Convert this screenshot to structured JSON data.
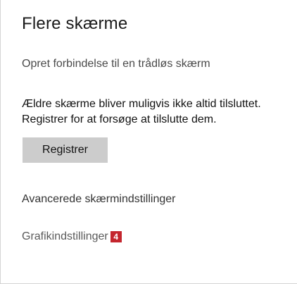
{
  "section": {
    "title": "Flere skærme",
    "connect_link": "Opret forbindelse til en trådløs skærm",
    "description_line1": "Ældre skærme bliver muligvis ikke altid tilsluttet.",
    "description_line2": "Registrer for at forsøge at tilslutte dem.",
    "register_button": "Registrer",
    "advanced_link": "Avancerede skærmindstillinger",
    "graphics_link": "Grafikindstillinger",
    "graphics_badge": "4"
  },
  "colors": {
    "button_bg": "#cccccc",
    "badge_bg": "#c4262e",
    "border": "#d4d4d4"
  }
}
